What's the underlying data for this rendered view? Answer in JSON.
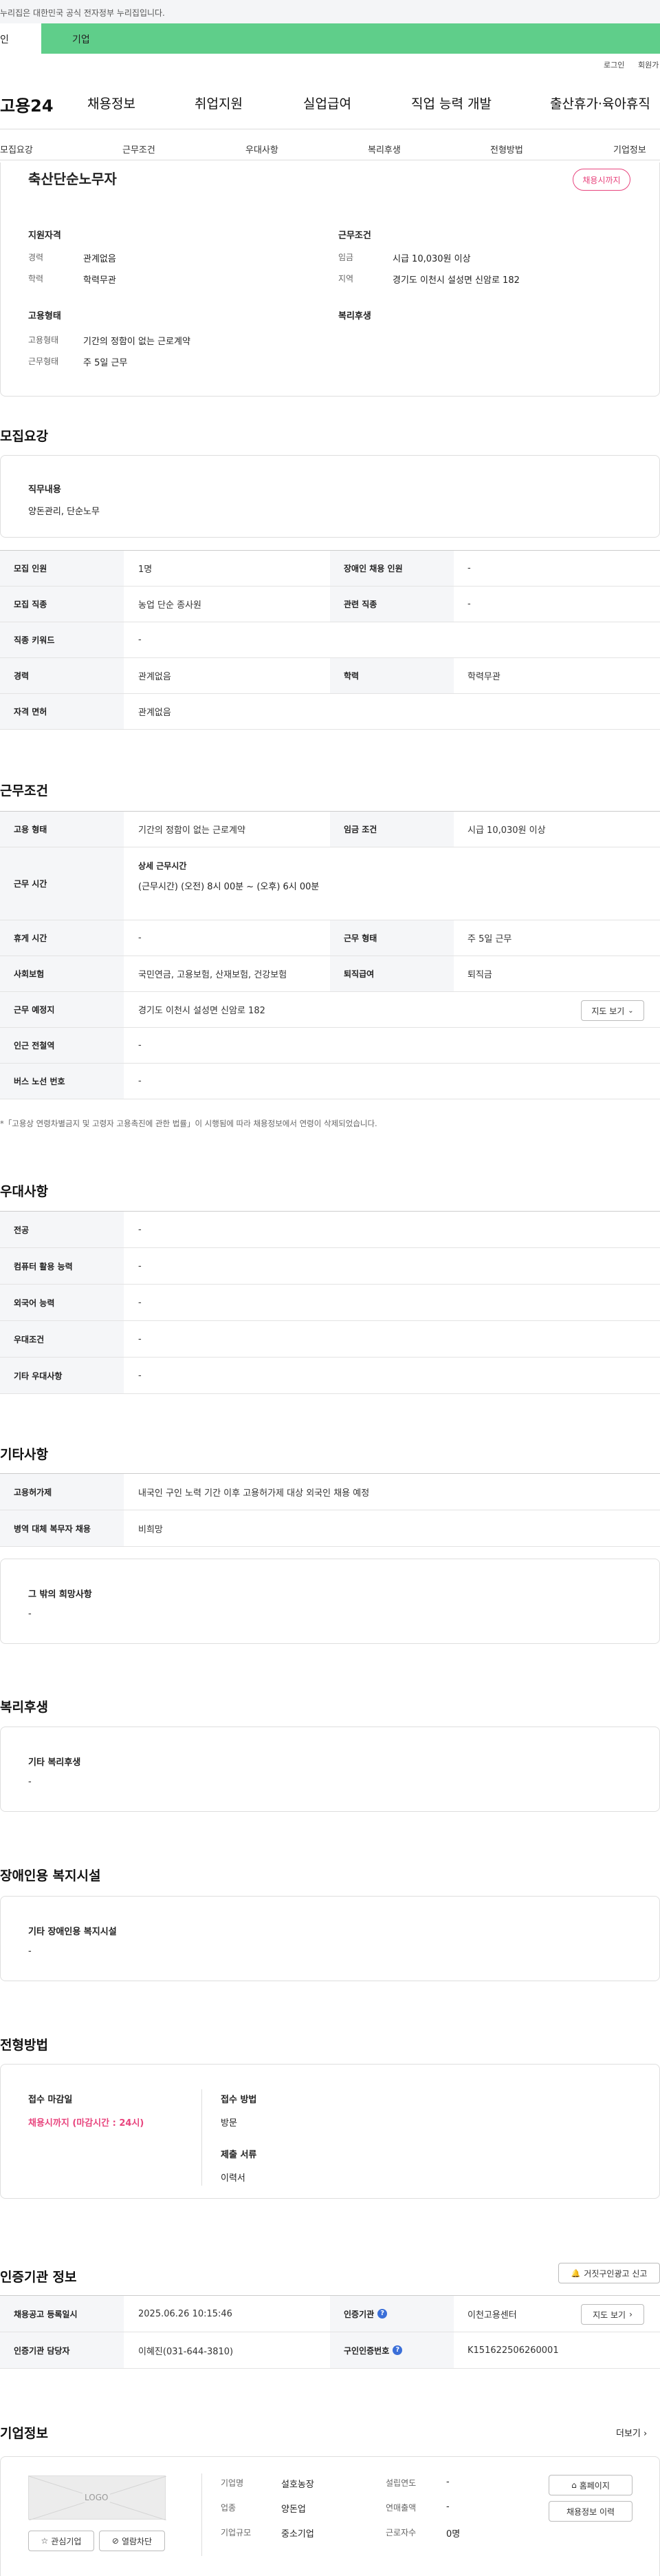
{
  "top": {
    "notice": "누리집은 대한민국 공식 전자정부 누리집입니다.",
    "tab_left": "인",
    "tab_right": "기업",
    "login": "로그인",
    "join": "회원가"
  },
  "gnb": {
    "logo": "고용24",
    "items": [
      "채용정보",
      "취업지원",
      "실업급여",
      "직업 능력 개발",
      "출산휴가·육아휴직"
    ]
  },
  "subtabs": [
    "모집요강",
    "근무조건",
    "우대사항",
    "복리후생",
    "전형방법",
    "기업정보"
  ],
  "summary": {
    "title": "축산단순노무자",
    "badge": "채용시까지",
    "qual_title": "지원자격",
    "qual": [
      {
        "label": "경력",
        "value": "관계없음"
      },
      {
        "label": "학력",
        "value": "학력무관"
      }
    ],
    "cond_title": "근무조건",
    "cond": [
      {
        "label": "임금",
        "value": "시급 10,030원 이상"
      },
      {
        "label": "지역",
        "value": "경기도 이천시 설성면 신암로 182"
      }
    ],
    "emp_title": "고용형태",
    "emp": [
      {
        "label": "고용형태",
        "value": "기간의 정함이 없는 근로계약"
      },
      {
        "label": "근무형태",
        "value": "주 5일 근무"
      }
    ],
    "welfare_title": "복리후생"
  },
  "recruit": {
    "title": "모집요강",
    "duty_label": "직무내용",
    "duty_value": "양돈관리, 단순노무",
    "rows": [
      {
        "th": "모집 인원",
        "td": "1명",
        "th2": "장애인 채용 인원",
        "td2": "-"
      },
      {
        "th": "모집 직종",
        "td": "농업 단순 종사원",
        "th2": "관련 직종",
        "td2": "-"
      },
      {
        "th": "직종 키워드",
        "td": "-"
      },
      {
        "th": "경력",
        "td": "관계없음",
        "th2": "학력",
        "td2": "학력무관"
      },
      {
        "th": "자격 면허",
        "td": "관계없음"
      }
    ]
  },
  "work": {
    "title": "근무조건",
    "r1": {
      "th": "고용 형태",
      "td": "기간의 정함이 없는 근로계약",
      "th2": "임금 조건",
      "td2": "시급 10,030원 이상"
    },
    "r2": {
      "th": "근무 시간",
      "sub": "상세 근무시간",
      "td": "(근무시간) (오전) 8시 00분 ~ (오후) 6시 00분"
    },
    "r3": {
      "th": "휴게 시간",
      "td": "-",
      "th2": "근무 형태",
      "td2": "주 5일 근무"
    },
    "r4": {
      "th": "사회보험",
      "td": "국민연금, 고용보험, 산재보험, 건강보험",
      "th2": "퇴직급여",
      "td2": "퇴직금"
    },
    "r5": {
      "th": "근무 예정지",
      "td": "경기도 이천시 설성면 신암로 182",
      "btn": "지도 보기"
    },
    "r6": {
      "th": "인근 전철역",
      "td": "-"
    },
    "r7": {
      "th": "버스 노선 번호",
      "td": "-"
    },
    "note": "*「고용상 연령차별금지 및 고령자 고용촉진에 관한 법률」이 시행됨에 따라 채용정보에서 연령이 삭제되었습니다."
  },
  "prefer": {
    "title": "우대사항",
    "rows": [
      {
        "th": "전공",
        "td": "-"
      },
      {
        "th": "컴퓨터 활용 능력",
        "td": "-"
      },
      {
        "th": "외국어 능력",
        "td": "-"
      },
      {
        "th": "우대조건",
        "td": "-"
      },
      {
        "th": "기타 우대사항",
        "td": "-"
      }
    ]
  },
  "etc": {
    "title": "기타사항",
    "rows": [
      {
        "th": "고용허가제",
        "td": "내국인 구인 노력 기간 이후 고용허가제 대상 외국인 채용 예정"
      },
      {
        "th": "병역 대체 복무자 채용",
        "td": "비희망"
      }
    ],
    "other_label": "그 밖의 희망사항",
    "other_value": "-"
  },
  "welfare": {
    "title": "복리후생",
    "label": "기타 복리후생",
    "value": "-"
  },
  "disab": {
    "title": "장애인용 복지시설",
    "label": "기타 장애인용 복지시설",
    "value": "-"
  },
  "process": {
    "title": "전형방법",
    "deadline_label": "접수 마감일",
    "deadline_value": "채용시까지 (마감시간 : 24시)",
    "method_label": "접수 방법",
    "method_value": "방문",
    "docs_label": "제출 서류",
    "docs_value": "이력서"
  },
  "cert": {
    "title": "인증기관 정보",
    "report_btn": "거짓구인광고 신고",
    "r1": {
      "th": "채용공고 등록일시",
      "td": "2025.06.26 10:15:46",
      "th2": "인증기관",
      "td2": "이천고용센터",
      "btn": "지도 보기"
    },
    "r2": {
      "th": "인증기관 담당자",
      "td": "이혜진(031-644-3810)",
      "th2": "구인인증번호",
      "td2": "K151622506260001"
    }
  },
  "company": {
    "title": "기업정보",
    "more": "더보기",
    "logo_text": "LOGO",
    "fav_btn": "관심기업",
    "block_btn": "열람차단",
    "fields": [
      {
        "label": "기업명",
        "value": "설호농장"
      },
      {
        "label": "업종",
        "value": "양돈업"
      },
      {
        "label": "기업규모",
        "value": "중소기업"
      }
    ],
    "fields2": [
      {
        "label": "설립연도",
        "value": "-"
      },
      {
        "label": "연매출액",
        "value": "-"
      },
      {
        "label": "근로자수",
        "value": "0명"
      }
    ],
    "home_btn": "홈페이지",
    "jobs_btn": "채용정보 이력"
  }
}
